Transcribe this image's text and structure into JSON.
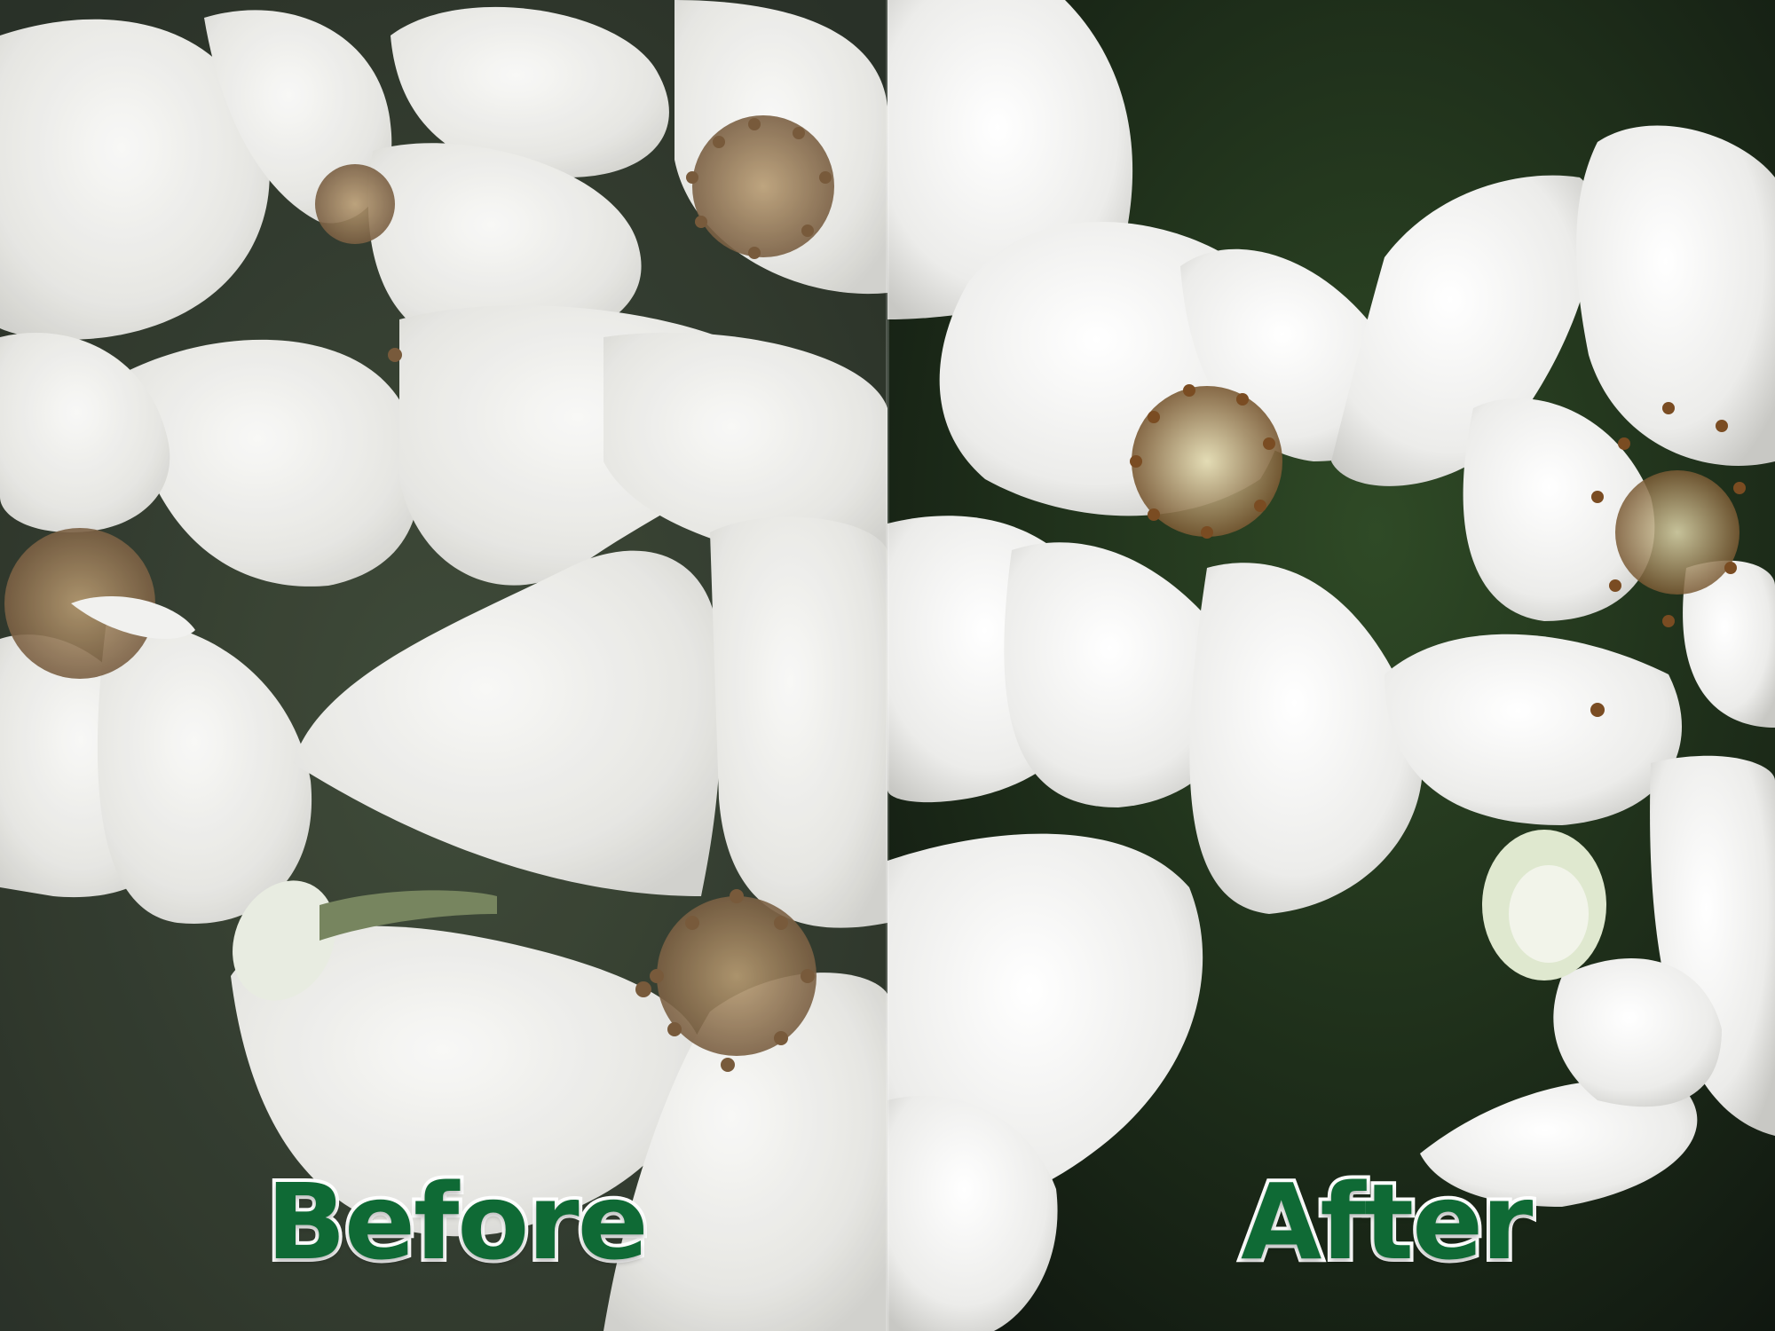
{
  "image": {
    "description_labels": {
      "before": "Before",
      "after": "After"
    },
    "colors": {
      "label_fill": "#0f6a35",
      "label_outline": "#ffffff",
      "background": "#1a2418",
      "petal": "#f2f2f0",
      "stamen": "#8a6a40"
    }
  }
}
